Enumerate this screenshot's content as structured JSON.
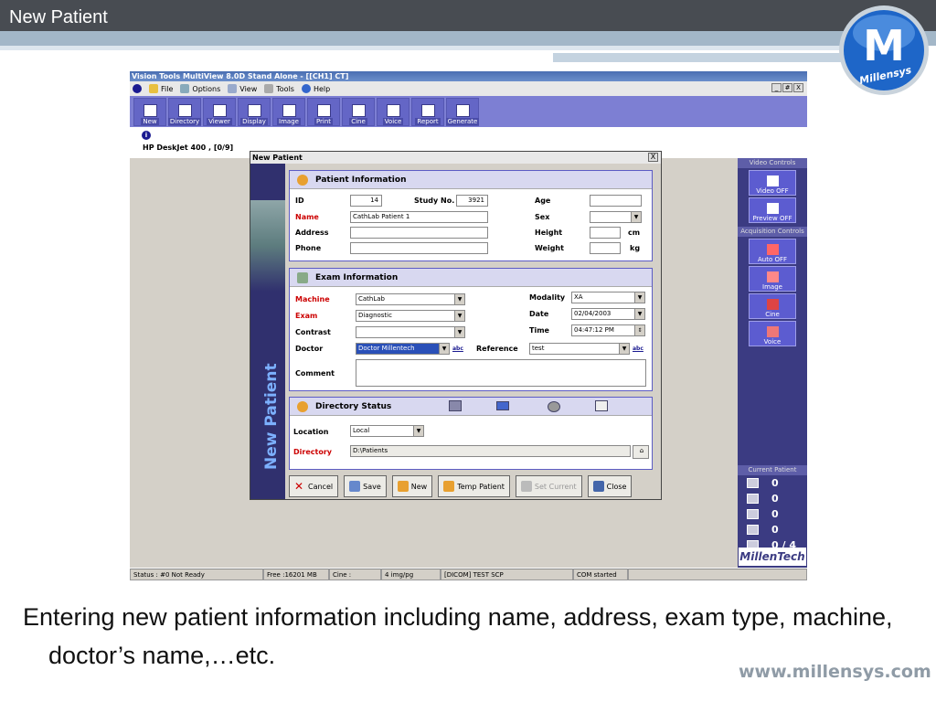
{
  "slide": {
    "title": "New Patient",
    "logo_letter": "M",
    "logo_text": "Millensys",
    "body_text": "Entering new patient information including name, address, exam type, machine, doctor’s name,…etc.",
    "website": "www.millensys.com"
  },
  "app": {
    "title": "Vision Tools MultiView 8.0D  Stand Alone - [[CH1] CT]",
    "menu": [
      "File",
      "Options",
      "View",
      "Tools",
      "Help"
    ],
    "window_controls": [
      "_",
      "#",
      "X"
    ],
    "toolbar": [
      "New",
      "Directory",
      "Viewer",
      "Display",
      "Image",
      "Print",
      "Cine",
      "Voice",
      "Report",
      "Generate"
    ],
    "printer": "HP DeskJet 400 , [0/9]",
    "right_panel": {
      "video_header": "Video Controls",
      "video_buttons": [
        "Video OFF",
        "Preview OFF"
      ],
      "acq_header": "Acquisition Controls",
      "acq_buttons": [
        "Auto OFF",
        "Image",
        "Cine",
        "Voice"
      ],
      "current_header": "Current Patient",
      "counts": [
        "0",
        "0",
        "0",
        "0",
        "0 / 4"
      ],
      "brand": "MillenTech"
    },
    "status": [
      "Status : #0 Not Ready",
      "Free :16201 MB",
      "Cine :",
      "4 img/pg",
      "[DICOM] TEST SCP",
      "COM started",
      ""
    ]
  },
  "dialog": {
    "title": "New Patient",
    "close": "X",
    "side_label": "New Patient",
    "patient": {
      "header": "Patient Information",
      "id_label": "ID",
      "id_value": "14",
      "study_label": "Study No.",
      "study_value": "3921",
      "name_label": "Name",
      "name_value": "CathLab Patient 1",
      "address_label": "Address",
      "address_value": "",
      "phone_label": "Phone",
      "phone_value": "",
      "age_label": "Age",
      "age_value": "",
      "sex_label": "Sex",
      "sex_value": "",
      "height_label": "Height",
      "height_value": "",
      "height_unit": "cm",
      "weight_label": "Weight",
      "weight_value": "",
      "weight_unit": "kg"
    },
    "exam": {
      "header": "Exam Information",
      "machine_label": "Machine",
      "machine_value": "CathLab",
      "exam_label": "Exam",
      "exam_value": "Diagnostic",
      "contrast_label": "Contrast",
      "contrast_value": "",
      "doctor_label": "Doctor",
      "doctor_value": "Doctor Millentech",
      "reference_label": "Reference",
      "reference_value": "test",
      "abc": "abc",
      "modality_label": "Modality",
      "modality_value": "XA",
      "date_label": "Date",
      "date_value": "02/04/2003",
      "time_label": "Time",
      "time_value": "04:47:12 PM",
      "comment_label": "Comment",
      "comment_value": ""
    },
    "directory": {
      "header": "Directory Status",
      "location_label": "Location",
      "location_value": "Local",
      "directory_label": "Directory",
      "directory_value": "D:\\Patients"
    },
    "buttons": [
      "Cancel",
      "Save",
      "New",
      "Temp Patient",
      "Set Current",
      "Close"
    ]
  },
  "colors": {
    "header_bar": "#484c52",
    "toolbar": "#7d7fd3",
    "right_panel": "#3b3b82",
    "required_label": "#cc0000"
  }
}
